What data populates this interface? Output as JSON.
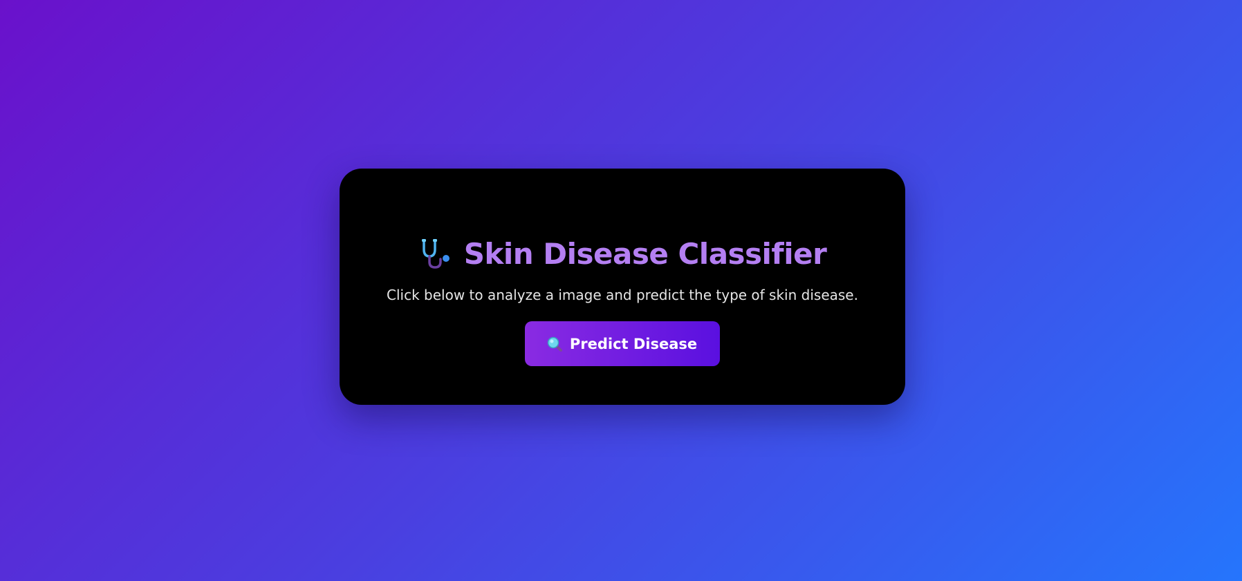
{
  "card": {
    "title": "Skin Disease Classifier",
    "title_icon": "stethoscope-icon",
    "subtitle": "Click below to analyze a image and predict the type of skin disease.",
    "button_label": "Predict Disease",
    "button_icon": "magnifier-icon"
  },
  "colors": {
    "background_start": "#6a11cb",
    "background_end": "#2575fc",
    "card_background": "#000000",
    "title": "#b47ff2",
    "subtitle": "#e6e6e6",
    "button_start": "#8a2be2",
    "button_end": "#5a10e0",
    "button_text": "#ffffff"
  }
}
